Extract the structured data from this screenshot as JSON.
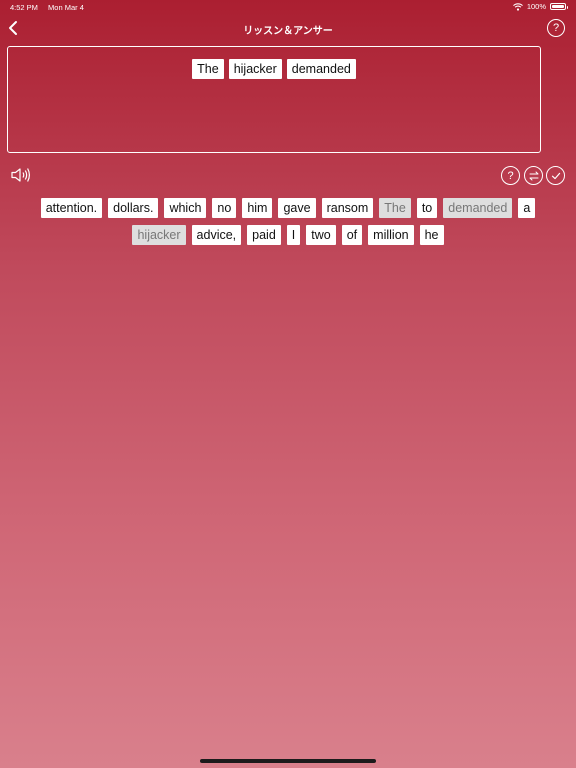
{
  "status_bar": {
    "time": "4:52 PM",
    "date": "Mon Mar 4",
    "battery": "100%",
    "battery_level": 1.0
  },
  "nav": {
    "title": "リッスン＆アンサー",
    "help_icon": "?"
  },
  "answer": {
    "words": [
      "The",
      "hijacker",
      "demanded"
    ]
  },
  "tools": {
    "hint_icon": "?",
    "icons": [
      "speaker-icon",
      "question-icon",
      "swap-icon",
      "check-icon"
    ]
  },
  "word_bank": {
    "rows": [
      [
        {
          "text": "attention.",
          "used": false
        },
        {
          "text": "dollars.",
          "used": false
        },
        {
          "text": "which",
          "used": false
        },
        {
          "text": "no",
          "used": false
        },
        {
          "text": "him",
          "used": false
        },
        {
          "text": "gave",
          "used": false
        },
        {
          "text": "ransom",
          "used": false
        },
        {
          "text": "The",
          "used": true
        },
        {
          "text": "to",
          "used": false
        },
        {
          "text": "demanded",
          "used": true
        },
        {
          "text": "a",
          "used": false
        }
      ],
      [
        {
          "text": "hijacker",
          "used": true
        },
        {
          "text": "advice,",
          "used": false
        },
        {
          "text": "paid",
          "used": false
        },
        {
          "text": "I",
          "used": false
        },
        {
          "text": "two",
          "used": false
        },
        {
          "text": "of",
          "used": false
        },
        {
          "text": "million",
          "used": false
        },
        {
          "text": "he",
          "used": false
        }
      ]
    ]
  },
  "colors": {
    "accent_top": "#ab1f31",
    "accent_bottom": "#d9808c",
    "tile": "#ffffff",
    "tile_used": "#dedede"
  }
}
